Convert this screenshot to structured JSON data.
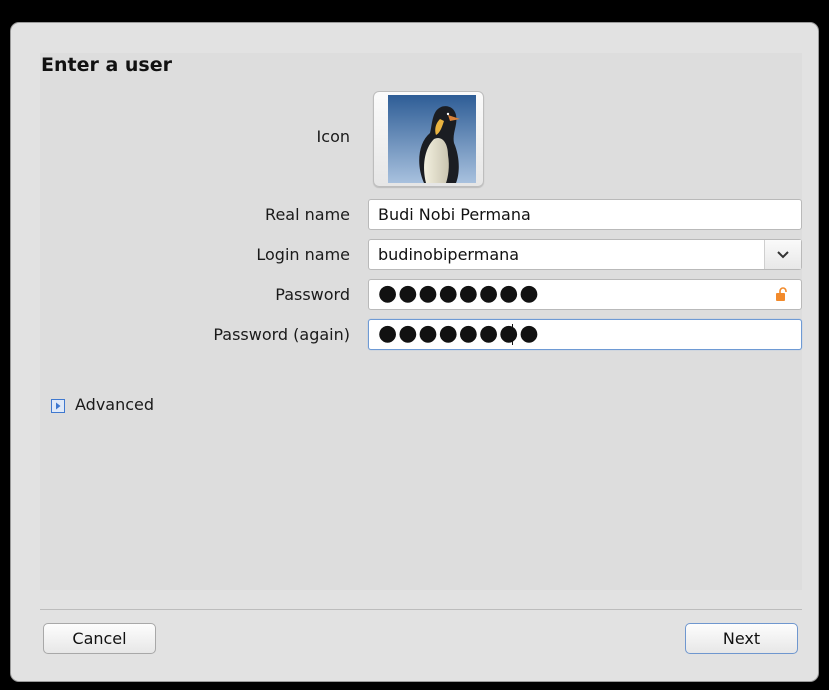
{
  "dialog": {
    "title": "Enter a user",
    "icon_label": "Icon",
    "icon_image": "penguin-avatar"
  },
  "form": {
    "real_name": {
      "label": "Real name",
      "value": "Budi Nobi Permana"
    },
    "login_name": {
      "label": "Login name",
      "value": "budinobipermana"
    },
    "password": {
      "label": "Password",
      "masked_value": "●●●●●●●●"
    },
    "password_again": {
      "label": "Password (again)",
      "masked_value": "●●●●●●●●"
    }
  },
  "advanced": {
    "label": "Advanced"
  },
  "buttons": {
    "cancel": "Cancel",
    "next": "Next"
  },
  "colors": {
    "focus_border": "#6e9ad4",
    "lock_icon": "#f28a2b",
    "expander_icon": "#3f78cf"
  }
}
